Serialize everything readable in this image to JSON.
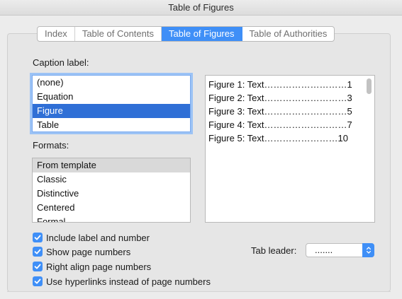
{
  "window": {
    "title": "Table of Figures"
  },
  "tabs": [
    {
      "label": "Index",
      "active": false
    },
    {
      "label": "Table of Contents",
      "active": false
    },
    {
      "label": "Table of Figures",
      "active": true
    },
    {
      "label": "Table of Authorities",
      "active": false
    }
  ],
  "caption": {
    "label": "Caption label:",
    "items": [
      "(none)",
      "Equation",
      "Figure",
      "Table"
    ],
    "selected": "Figure"
  },
  "formats": {
    "label": "Formats:",
    "items": [
      "From template",
      "Classic",
      "Distinctive",
      "Centered",
      "Formal"
    ],
    "selected": "From template"
  },
  "preview": {
    "lines": [
      "Figure 1: Text………………………1",
      "Figure 2: Text………………………3",
      "Figure 3: Text………………………5",
      "Figure 4: Text………………………7",
      "Figure 5: Text……………………10"
    ]
  },
  "options": {
    "include_label": {
      "label": "Include label and number",
      "checked": true
    },
    "show_page_numbers": {
      "label": "Show page numbers",
      "checked": true
    },
    "right_align": {
      "label": "Right align page numbers",
      "checked": true
    },
    "hyperlinks": {
      "label": "Use hyperlinks instead of page numbers",
      "checked": true
    }
  },
  "tab_leader": {
    "label": "Tab leader:",
    "value": "......."
  },
  "colors": {
    "accent": "#3f8ff7",
    "selection": "#2f6fd6",
    "focus_ring": "#9cc3f5"
  },
  "icons": {
    "checkbox": "checkmark-icon",
    "select": "up-down-chevron-icon"
  }
}
